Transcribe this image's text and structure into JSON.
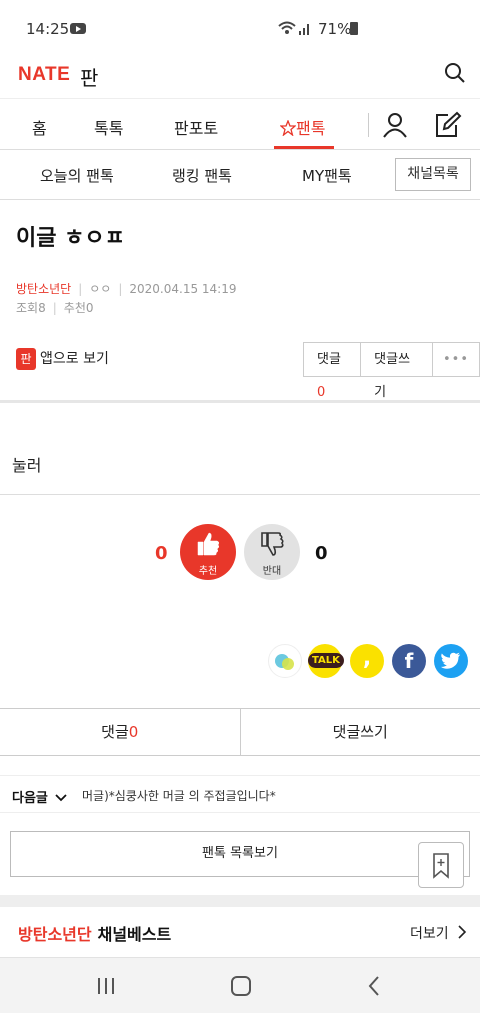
{
  "status_bar": {
    "time": "14:25",
    "battery": "71%"
  },
  "app": {
    "logo": "NATE",
    "logo_sub": "판"
  },
  "nav": {
    "items": [
      "홈",
      "톡톡",
      "판포토",
      "팬톡"
    ],
    "active": "팬톡"
  },
  "subnav": {
    "items": [
      "오늘의 팬톡",
      "랭킹 팬톡",
      "MY팬톡"
    ],
    "channel_button": "채널목록"
  },
  "post": {
    "title": "이글 ㅎㅇㅍ",
    "channel": "방탄소년단",
    "author": "ㅇㅇ",
    "date": "2020.04.15 14:19",
    "views_label": "조회",
    "views": "8",
    "recommend_label": "추천",
    "recommend": "0",
    "app_view": "앱으로 보기",
    "app_icon_text": "판",
    "body": "눌러"
  },
  "actions": {
    "comment_label": "댓글",
    "comment_count": "0",
    "write_comment": "댓글쓰기",
    "more": "•••"
  },
  "votes": {
    "up_count": "0",
    "up_label": "추천",
    "down_count": "0",
    "down_label": "반대"
  },
  "share": {
    "kakao_talk": "TALK",
    "kakao_story": ",",
    "facebook": "f"
  },
  "comment_bar": {
    "comment_label": "댓글",
    "comment_count": "0",
    "write_comment": "댓글쓰기"
  },
  "next_post": {
    "label": "다음글",
    "title": "머글)*심쿵사한 머글 의 주접글입니다*"
  },
  "list_button": "팬톡 목록보기",
  "channel_best": {
    "channel": "방탄소년단",
    "label": "채널베스트",
    "more": "더보기"
  },
  "colors": {
    "accent": "#e8372a",
    "kakao": "#fae100",
    "facebook": "#3b5998",
    "twitter": "#1da1f2"
  }
}
